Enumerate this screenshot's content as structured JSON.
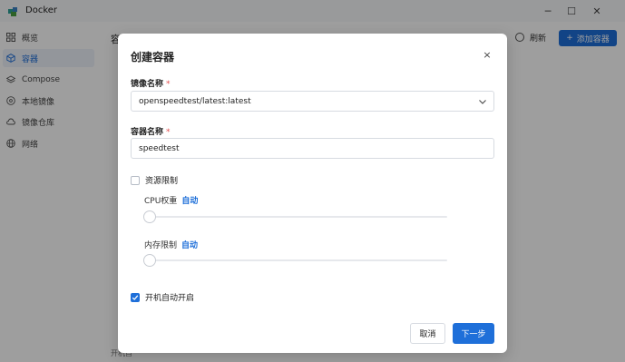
{
  "window": {
    "title": "Docker",
    "minimize_glyph": "─",
    "maximize_glyph": "☐",
    "close_glyph": "✕"
  },
  "sidebar": {
    "items": [
      {
        "label": "概览",
        "icon": "grid-icon",
        "active": false
      },
      {
        "label": "容器",
        "icon": "cube-icon",
        "active": true
      },
      {
        "label": "Compose",
        "icon": "layers-icon",
        "active": false
      },
      {
        "label": "本地镜像",
        "icon": "disc-icon",
        "active": false
      },
      {
        "label": "镜像仓库",
        "icon": "cloud-icon",
        "active": false
      },
      {
        "label": "网络",
        "icon": "globe-icon",
        "active": false
      }
    ]
  },
  "main": {
    "heading": "容",
    "refresh_label": "刷新",
    "add_label": "添加容器",
    "add_glyph": "+",
    "footer_text": "开机自"
  },
  "dialog": {
    "title": "创建容器",
    "close_glyph": "×",
    "image_label": "镜像名称",
    "required_mark": "*",
    "image_value": "openspeedtest/latest:latest",
    "name_label": "容器名称",
    "name_value": "speedtest",
    "resource_limit_label": "资源限制",
    "resource_limit_checked": false,
    "cpu_label": "CPU权重",
    "cpu_value": "自动",
    "cpu_level": 0,
    "memory_label": "内存限制",
    "memory_value": "自动",
    "memory_level": 0,
    "autostart_label": "开机自动开启",
    "autostart_checked": true,
    "cancel_label": "取消",
    "next_label": "下一步"
  },
  "colors": {
    "accent": "#1e6fd9",
    "required": "#e34d4d",
    "overlay": "rgba(0,0,0,0.38)"
  }
}
